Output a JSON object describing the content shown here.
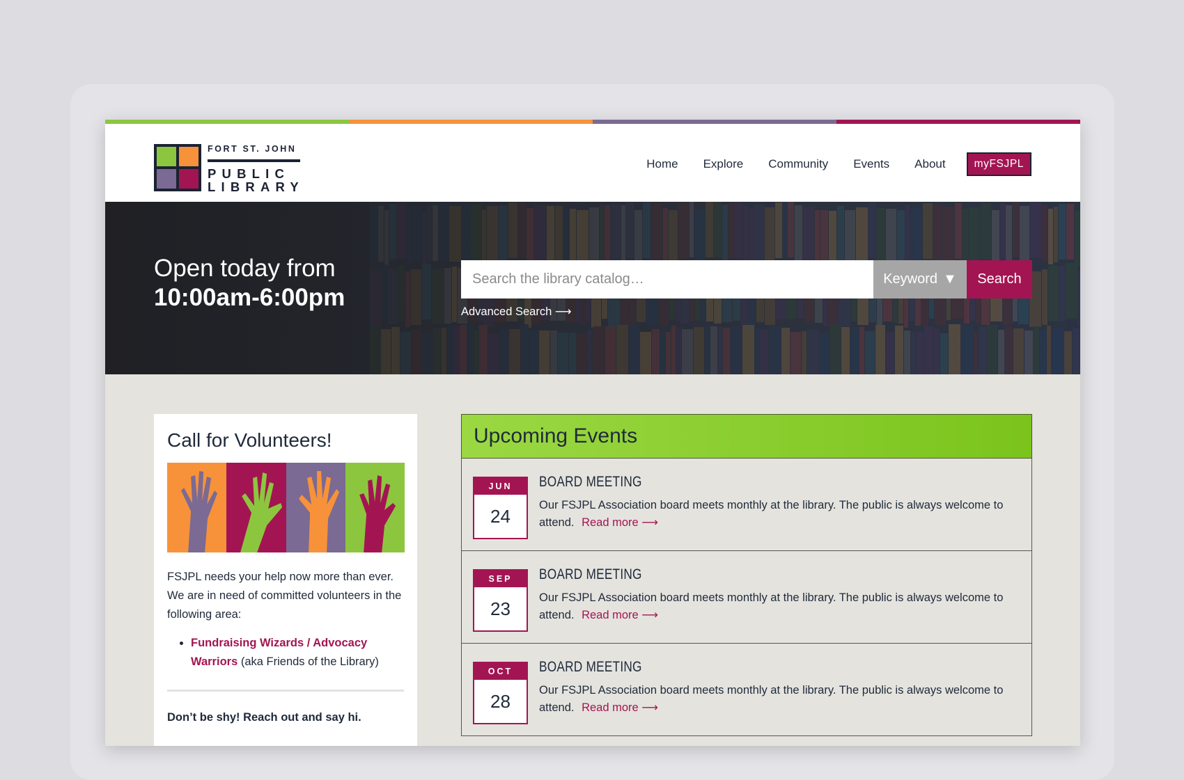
{
  "colors": {
    "brand_green": "#8cc63f",
    "brand_orange": "#f7923a",
    "brand_purple": "#7b6a93",
    "brand_magenta": "#a31552",
    "navy": "#1b2233"
  },
  "logo": {
    "line1": "FORT ST. JOHN",
    "line2": "PUBLIC",
    "line3": "LIBRARY"
  },
  "nav": {
    "items": [
      "Home",
      "Explore",
      "Community",
      "Events",
      "About"
    ],
    "account_label": "myFSJPL"
  },
  "hero": {
    "hours_prefix": "Open today from",
    "hours_value": "10:00am-6:00pm",
    "search_placeholder": "Search the library catalog…",
    "search_type": "Keyword",
    "search_button": "Search",
    "advanced_search": "Advanced Search ⟶"
  },
  "volunteers": {
    "title": "Call for Volunteers!",
    "body": "FSJPL needs your help now more than ever. We are in need of committed volunteers in the following area:",
    "list_link": "Fundraising Wizards / Advocacy Warriors",
    "list_suffix": "(aka Friends of the Library)",
    "closing": "Don’t be shy! Reach out and say hi."
  },
  "events": {
    "heading": "Upcoming Events",
    "read_more": "Read more ⟶",
    "items": [
      {
        "month": "JUN",
        "day": "24",
        "title": "BOARD MEETING",
        "description": "Our FSJPL Association board meets monthly at the library. The public is always welcome to attend."
      },
      {
        "month": "SEP",
        "day": "23",
        "title": "BOARD MEETING",
        "description": "Our FSJPL Association board meets monthly at the library. The public is always welcome to attend."
      },
      {
        "month": "OCT",
        "day": "28",
        "title": "BOARD MEETING",
        "description": "Our FSJPL Association board meets monthly at the library. The public is always welcome to attend."
      }
    ]
  }
}
